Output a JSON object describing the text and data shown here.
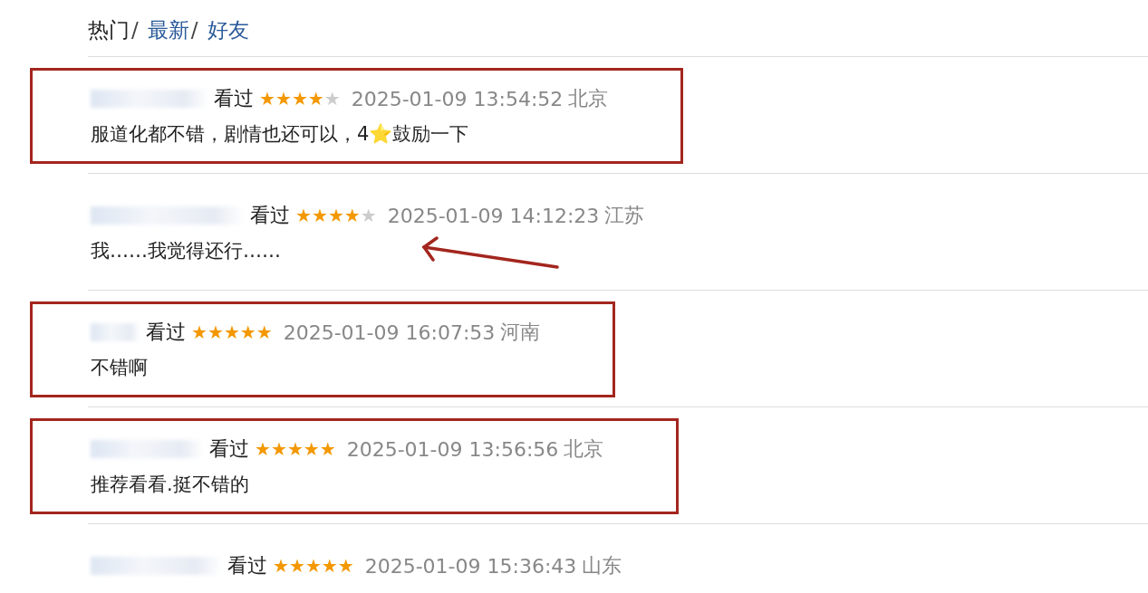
{
  "tabs": [
    {
      "label": "热门",
      "separator": "/",
      "selected": true
    },
    {
      "label": "最新",
      "separator": "/",
      "selected": false
    },
    {
      "label": "好友",
      "selected": false
    }
  ],
  "reviews": [
    {
      "action": "看过",
      "stars": 4,
      "time": "2025-01-09 13:54:52",
      "location": "北京",
      "comment": "服道化都不错，剧情也还可以，4⭐鼓励一下",
      "highlighted": true,
      "arrow": false
    },
    {
      "action": "看过",
      "stars": 4,
      "time": "2025-01-09 14:12:23",
      "location": "江苏",
      "comment": "我……我觉得还行……",
      "highlighted": false,
      "arrow": true
    },
    {
      "action": "看过",
      "stars": 5,
      "time": "2025-01-09 16:07:53",
      "location": "河南",
      "comment": "不错啊",
      "highlighted": true,
      "arrow": false
    },
    {
      "action": "看过",
      "stars": 5,
      "time": "2025-01-09 13:56:56",
      "location": "北京",
      "comment": "推荐看看.挺不错的",
      "highlighted": true,
      "arrow": false
    },
    {
      "action": "看过",
      "stars": 5,
      "time": "2025-01-09 15:36:43",
      "location": "山东",
      "highlighted": false,
      "arrow": false
    }
  ]
}
